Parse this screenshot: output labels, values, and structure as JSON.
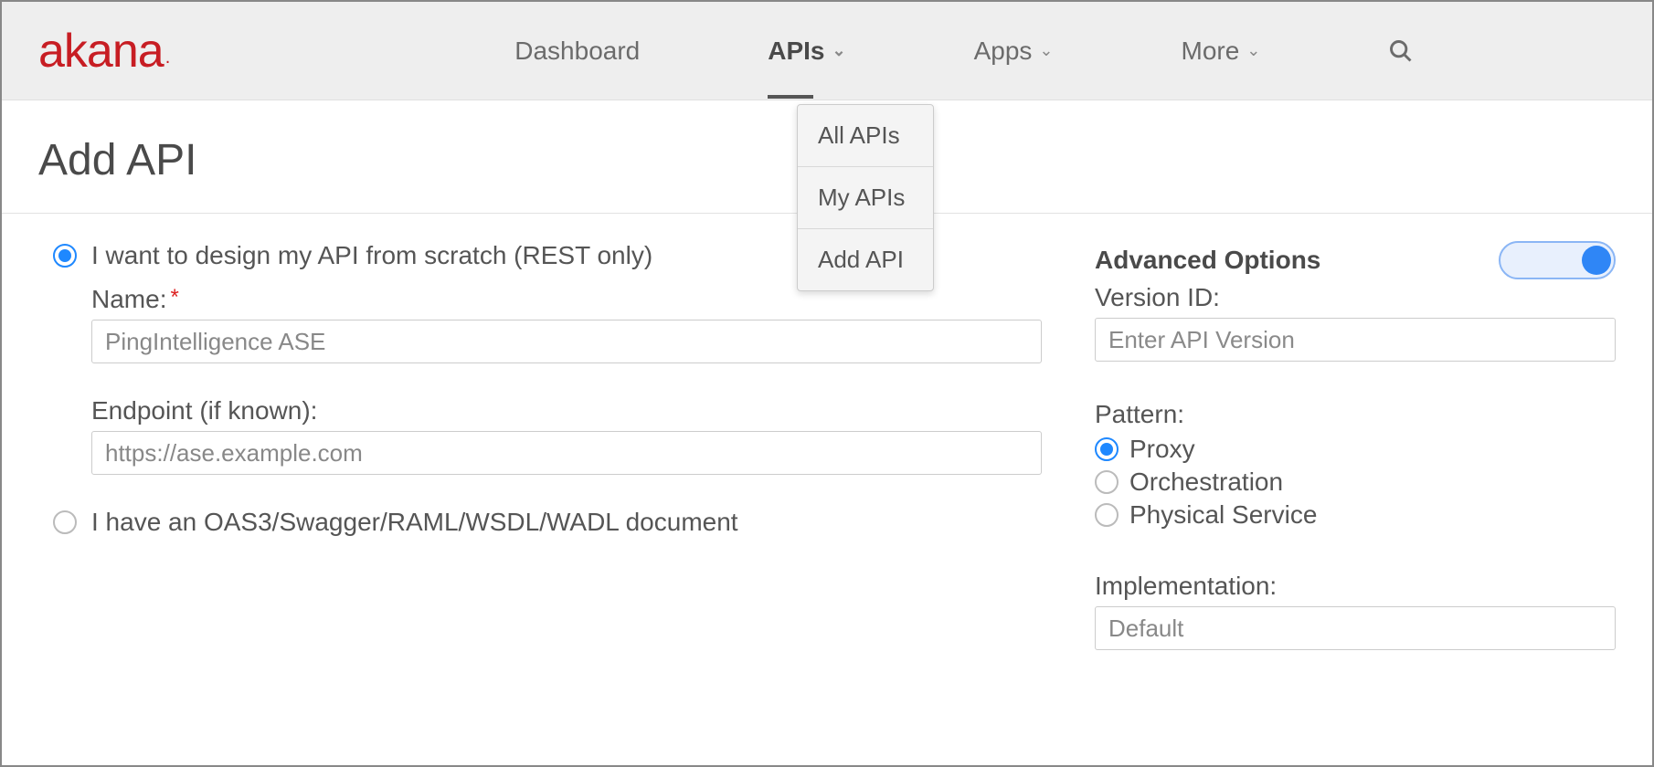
{
  "brand": "akana",
  "nav": {
    "dashboard": "Dashboard",
    "apis": "APIs",
    "apps": "Apps",
    "more": "More"
  },
  "dropdown": {
    "all": "All APIs",
    "my": "My APIs",
    "add": "Add API"
  },
  "page_title": "Add API",
  "left": {
    "opt1": "I want to design my API from scratch (REST only)",
    "name_label": "Name:",
    "name_value": "PingIntelligence ASE",
    "endpoint_label": "Endpoint (if known):",
    "endpoint_value": "https://ase.example.com",
    "opt2": "I have an OAS3/Swagger/RAML/WSDL/WADL document"
  },
  "right": {
    "adv_title": "Advanced Options",
    "version_label": "Version ID:",
    "version_placeholder": "Enter API Version",
    "pattern_label": "Pattern:",
    "pattern_proxy": "Proxy",
    "pattern_orch": "Orchestration",
    "pattern_phys": "Physical Service",
    "impl_label": "Implementation:",
    "impl_value": "Default"
  }
}
